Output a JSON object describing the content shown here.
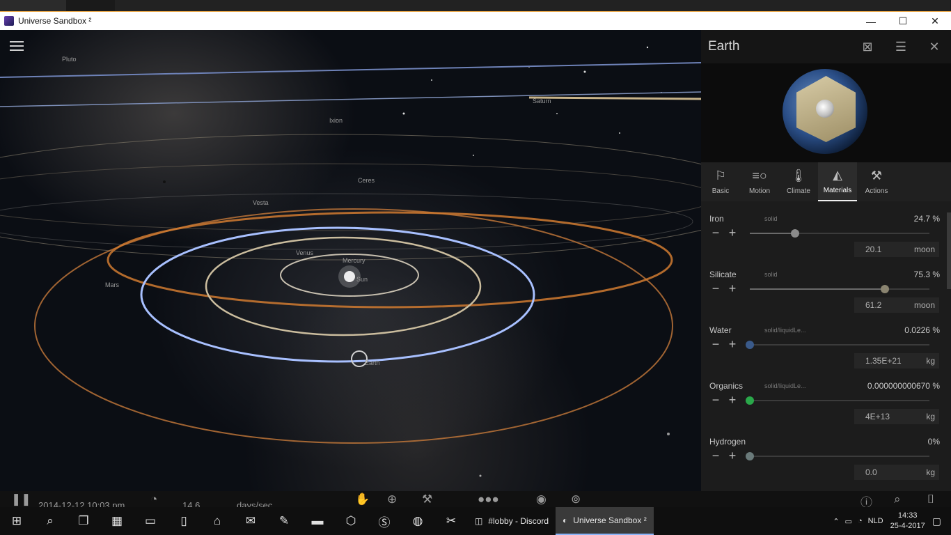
{
  "window": {
    "title": "Universe Sandbox ²",
    "minimize": "—",
    "maximize": "☐",
    "close": "✕"
  },
  "viewport": {
    "labels": {
      "pluto": "Pluto",
      "saturn": "Saturn",
      "ixion": "Ixion",
      "ceres": "Ceres",
      "vesta": "Vesta",
      "venus": "Venus",
      "mercury": "Mercury",
      "sun": "Sun",
      "mars": "Mars",
      "earth": "Earth"
    }
  },
  "panel": {
    "name": "Earth",
    "tabs": [
      {
        "label": "Basic",
        "icon": "bookmark-icon"
      },
      {
        "label": "Motion",
        "icon": "motion-icon"
      },
      {
        "label": "Climate",
        "icon": "thermometer-icon"
      },
      {
        "label": "Materials",
        "icon": "materials-icon",
        "active": true
      },
      {
        "label": "Actions",
        "icon": "hammer-icon"
      }
    ],
    "materials": [
      {
        "name": "Iron",
        "state": "solid",
        "percent": "24.7 %",
        "value": "20.1",
        "unit": "moon",
        "slider": 0.25,
        "color": "#8a8a8a"
      },
      {
        "name": "Silicate",
        "state": "solid",
        "percent": "75.3 %",
        "value": "61.2",
        "unit": "moon",
        "slider": 0.753,
        "color": "#8a8470"
      },
      {
        "name": "Water",
        "state": "solid/liquidLe...",
        "percent": "0.0226 %",
        "value": "1.35E+21",
        "unit": "kg",
        "slider": 0.0,
        "color": "#3a5a8a"
      },
      {
        "name": "Organics",
        "state": "solid/liquidLe...",
        "percent": "0.000000000670 %",
        "value": "4E+13",
        "unit": "kg",
        "slider": 0.0,
        "color": "#2aa84a"
      },
      {
        "name": "Hydrogen",
        "state": "",
        "percent": "0%",
        "value": "0.0",
        "unit": "kg",
        "slider": 0.0,
        "color": "#6a7a7a"
      }
    ]
  },
  "bottombar": {
    "date": "2014-12-12 10:03 pm",
    "speed": "14.6",
    "speed_unit": "days/sec"
  },
  "taskbar": {
    "apps": [
      {
        "label": "#lobby - Discord"
      },
      {
        "label": "Universe Sandbox ²"
      }
    ],
    "tray": {
      "lang": "NLD",
      "time": "14:33",
      "date": "25-4-2017"
    }
  }
}
